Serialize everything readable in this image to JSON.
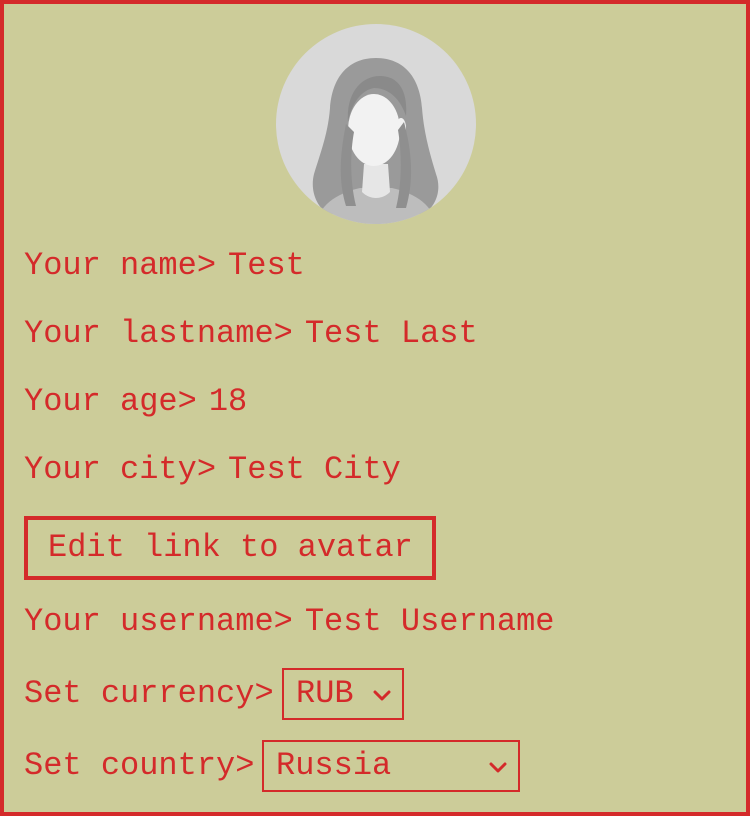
{
  "profile": {
    "avatar_icon": "female-avatar-placeholder-icon",
    "fields": [
      {
        "label": "Your name>",
        "value": "Test"
      },
      {
        "label": "Your lastname>",
        "value": "Test Last"
      },
      {
        "label": "Your age>",
        "value": "18"
      },
      {
        "label": "Your city>",
        "value": "Test City"
      }
    ],
    "edit_avatar_label": "Edit link to avatar",
    "username": {
      "label": "Your username>",
      "value": "Test Username"
    },
    "currency": {
      "label": "Set currency>",
      "selected": "RUB"
    },
    "country": {
      "label": "Set country>",
      "selected": "Russia"
    }
  },
  "colors": {
    "background": "#cccc99",
    "accent": "#d42a2a",
    "avatar_bg": "#d9d9d9"
  }
}
